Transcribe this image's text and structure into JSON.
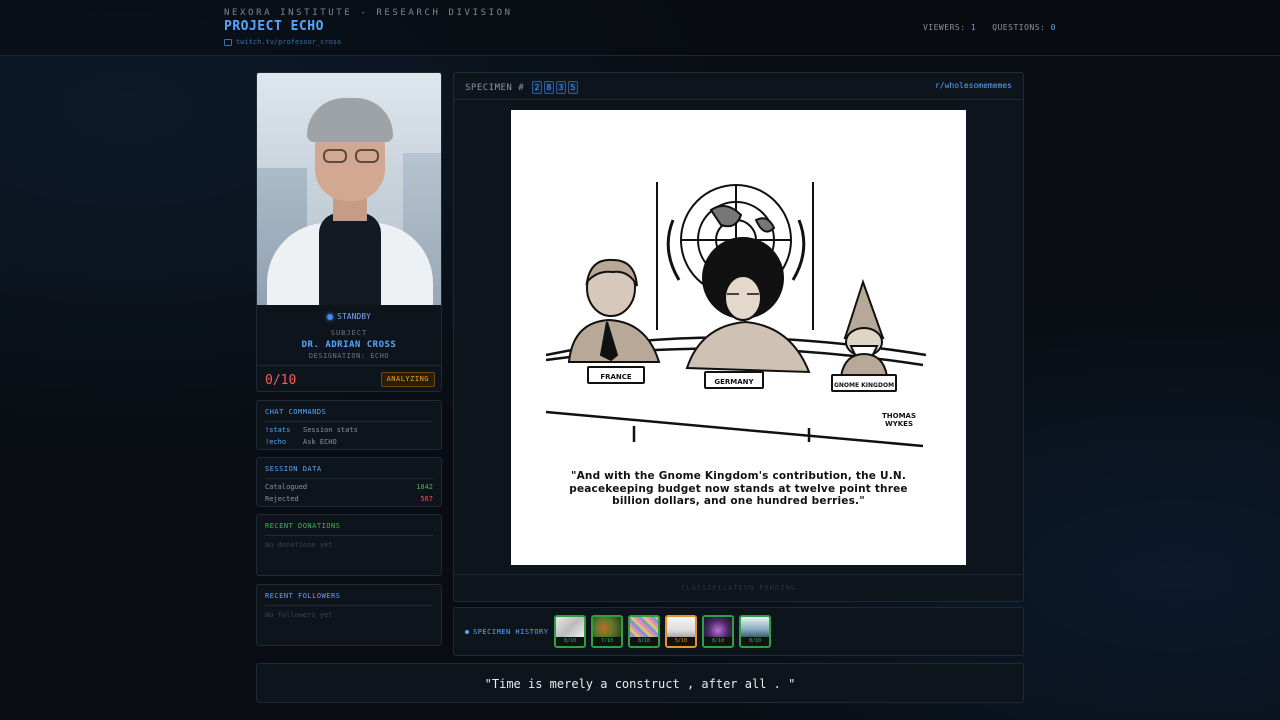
{
  "header": {
    "org": "NEXORA INSTITUTE - RESEARCH DIVISION",
    "title": "PROJECT ECHO",
    "channel": "twitch.tv/professor_cross",
    "viewers_label": "VIEWERS:",
    "viewers": "1",
    "questions_label": "QUESTIONS:",
    "questions": "0"
  },
  "subject": {
    "status": "STANDBY",
    "label": "SUBJECT",
    "name": "DR. ADRIAN CROSS",
    "designation": "DESIGNATION: ECHO",
    "score": "0/10",
    "state_badge": "ANALYZING"
  },
  "chat_commands": {
    "title": "CHAT COMMANDS",
    "items": [
      {
        "cmd": "!stats",
        "desc": "Session stats"
      },
      {
        "cmd": "!echo",
        "desc": "Ask ECHO"
      }
    ]
  },
  "session_data": {
    "title": "SESSION DATA",
    "catalogued_label": "Catalogued",
    "catalogued": "1842",
    "rejected_label": "Rejected",
    "rejected": "567"
  },
  "donations": {
    "title": "RECENT DONATIONS",
    "empty": "No donations yet"
  },
  "followers": {
    "title": "RECENT FOLLOWERS",
    "empty": "No followers yet"
  },
  "specimen": {
    "label": "SPECIMEN #",
    "digits": [
      "2",
      "8",
      "3",
      "5"
    ],
    "subreddit": "r/wholesomememes",
    "cartoon_labels": {
      "france": "FRANCE",
      "germany": "GERMANY",
      "gnome": "GNOME KINGDOM",
      "signature_1": "THOMAS",
      "signature_2": "WYKES"
    },
    "caption": "\"And with the Gnome Kingdom's contribution, the U.N. peacekeeping budget now stands at twelve point three billion dollars, and one hundred berries.\"",
    "classification": "CLASSIFICATION PENDING"
  },
  "history": {
    "label": "SPECIMEN HISTORY",
    "items": [
      {
        "score": "8/10",
        "status": "green"
      },
      {
        "score": "7/10",
        "status": "green"
      },
      {
        "score": "8/10",
        "status": "green"
      },
      {
        "score": "5/10",
        "status": "orange"
      },
      {
        "score": "8/10",
        "status": "green"
      },
      {
        "score": "8/10",
        "status": "green"
      }
    ]
  },
  "quote": "\"Time is merely a construct , after all . \"",
  "colors": {
    "accent": "#58a6ff",
    "success": "#3fb950",
    "danger": "#f85149",
    "warning": "#f0a030",
    "background": "#090d13"
  }
}
